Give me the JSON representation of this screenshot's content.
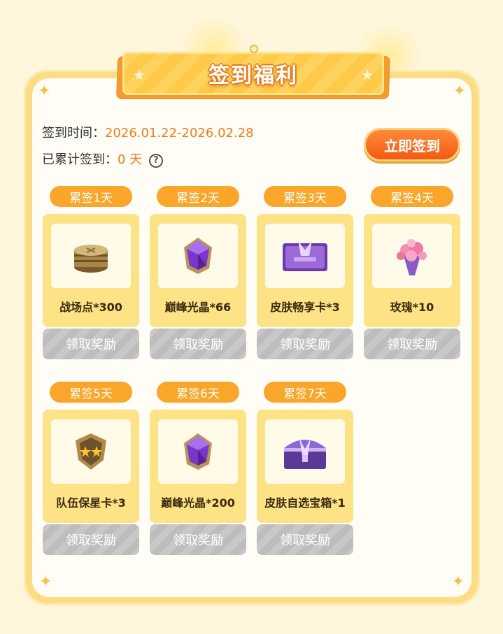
{
  "title": "签到福利",
  "signin_time": {
    "label": "签到时间：",
    "value": "2026.01.22-2026.02.28"
  },
  "cumulative": {
    "label": "已累计签到：",
    "value": "0 天",
    "help_icon": "question-circle-icon"
  },
  "checkin_button": "立即签到",
  "rewards": [
    {
      "day": "累签1天",
      "name": "战场点*300",
      "icon": "coin-stack-icon",
      "action": "领取奖励"
    },
    {
      "day": "累签2天",
      "name": "巅峰光晶*66",
      "icon": "purple-crystal-icon",
      "action": "领取奖励"
    },
    {
      "day": "累签3天",
      "name": "皮肤畅享卡*3",
      "icon": "purple-card-icon",
      "action": "领取奖励"
    },
    {
      "day": "累签4天",
      "name": "玫瑰*10",
      "icon": "rose-bouquet-icon",
      "action": "领取奖励"
    },
    {
      "day": "累签5天",
      "name": "队伍保星卡*3",
      "icon": "star-shield-icon",
      "action": "领取奖励"
    },
    {
      "day": "累签6天",
      "name": "巅峰光晶*200",
      "icon": "purple-crystal-icon",
      "action": "领取奖励"
    },
    {
      "day": "累签7天",
      "name": "皮肤自选宝箱*1",
      "icon": "treasure-chest-icon",
      "action": "领取奖励"
    }
  ],
  "colors": {
    "accent": "#f07a1d",
    "pill": "#f9a62a",
    "card": "#fde286",
    "disabled": "#c4c4c4"
  }
}
